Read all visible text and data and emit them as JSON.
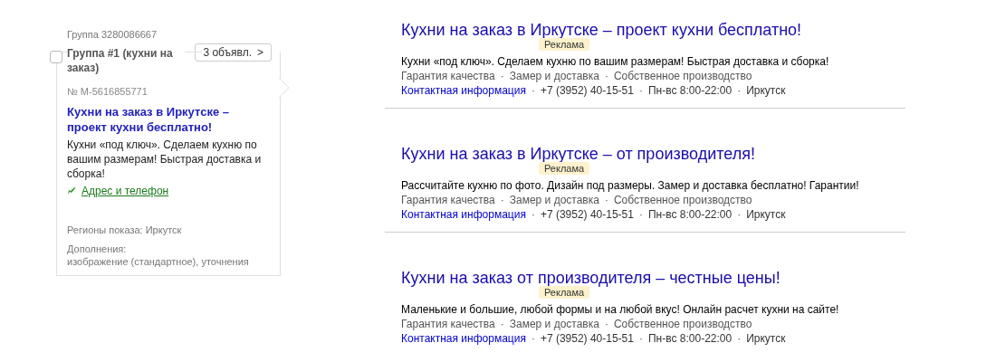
{
  "group": {
    "id_label": "Группа 3280086667",
    "name": "Группа #1 (кухни на заказ)",
    "checked": false,
    "ads_button": "3 объявл.",
    "ads_button_arrow": ">"
  },
  "card": {
    "number": "№ M-5616855771",
    "title": "Кухни на заказ в Иркутске – проект кухни бесплатно!",
    "text": "Кухни «под ключ». Сделаем кухню по вашим размерам! Быстрая доставка и сборка!",
    "contact_link": "Адрес и телефон",
    "regions": "Регионы показа: Иркутск",
    "extras_label": "Дополнения:",
    "extras": "изображение (стандартное), уточнения"
  },
  "ads": [
    {
      "title": "Кухни на заказ в Иркутске – проект кухни бесплатно!",
      "badge": "Реклама",
      "text": "Кухни «под ключ». Сделаем кухню по вашим размерам! Быстрая доставка и сборка!",
      "separator": "·",
      "sitelinks": [
        "Гарантия качества",
        "Замер и доставка",
        "Собственное производство"
      ],
      "contact_link": "Контактная информация",
      "contacts": [
        "+7 (3952) 40-15-51",
        "Пн-вс 8:00-22:00",
        "Иркутск"
      ]
    },
    {
      "title": "Кухни на заказ в Иркутске – от производителя!",
      "badge": "Реклама",
      "text": "Рассчитайте кухню по фото. Дизайн под размеры. Замер и доставка бесплатно! Гарантии!",
      "separator": "·",
      "sitelinks": [
        "Гарантия качества",
        "Замер и доставка",
        "Собственное производство"
      ],
      "contact_link": "Контактная информация",
      "contacts": [
        "+7 (3952) 40-15-51",
        "Пн-вс 8:00-22:00",
        "Иркутск"
      ]
    },
    {
      "title": "Кухни на заказ от производителя – честные цены!",
      "badge": "Реклама",
      "text": "Маленькие и большие, любой формы и на любой вкус! Онлайн расчет кухни на сайте!",
      "separator": "·",
      "sitelinks": [
        "Гарантия качества",
        "Замер и доставка",
        "Собственное производство"
      ],
      "contact_link": "Контактная информация",
      "contacts": [
        "+7 (3952) 40-15-51",
        "Пн-вс 8:00-22:00",
        "Иркутск"
      ]
    }
  ]
}
